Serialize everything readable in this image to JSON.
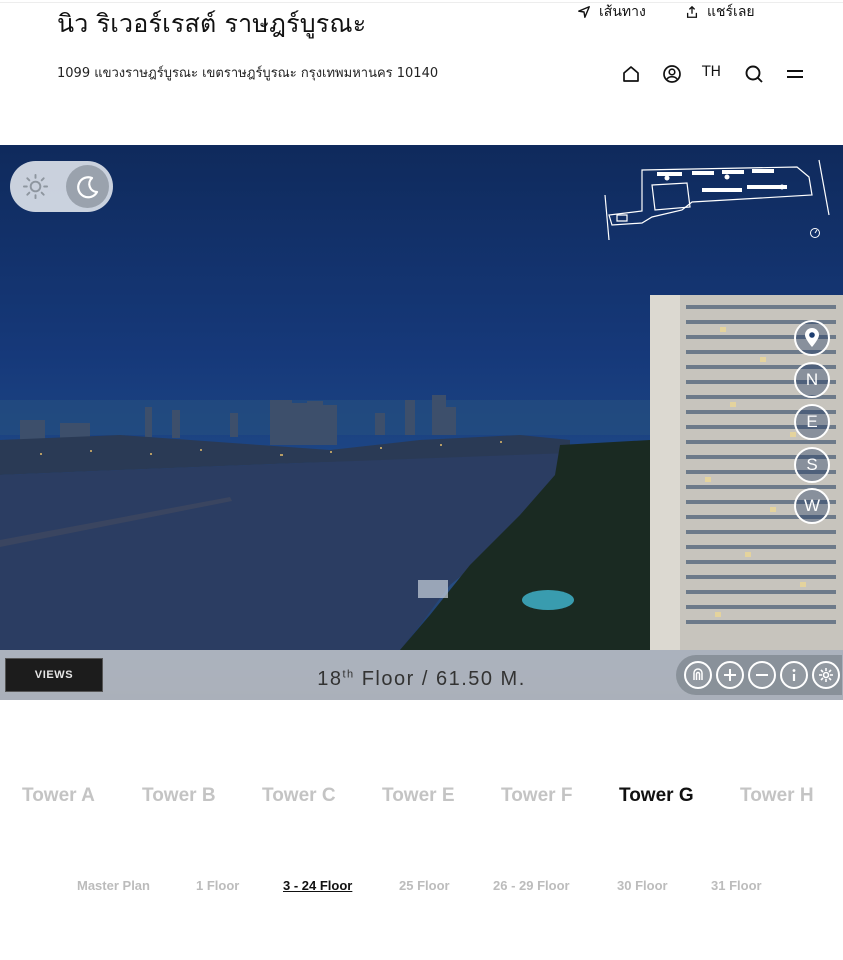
{
  "header": {
    "title": "นิว ริเวอร์เรสต์ ราษฎร์บูรณะ",
    "address": "1099 แขวงราษฎร์บูรณะ เขตราษฎร์บูรณะ กรุงเทพมหานคร 10140",
    "route_label": "เส้นทาง",
    "share_label": "แชร์เลย",
    "lang": "TH",
    "icons": [
      "home-icon",
      "user-icon",
      "search-icon",
      "menu-icon"
    ]
  },
  "viewer": {
    "mode_options": [
      "day",
      "night"
    ],
    "active_mode": "night",
    "compass": [
      "N",
      "E",
      "S",
      "W"
    ],
    "views_label": "VIEWS",
    "floor_ordinal": "18",
    "floor_suffix": "th",
    "floor_text": "Floor / 61.50 M.",
    "tools": [
      "gyro-icon",
      "zoom-in-icon",
      "zoom-out-icon",
      "info-icon",
      "settings-icon"
    ]
  },
  "tower_tabs": [
    {
      "label": "Tower A",
      "active": false
    },
    {
      "label": "Tower B",
      "active": false
    },
    {
      "label": "Tower C",
      "active": false
    },
    {
      "label": "Tower E",
      "active": false
    },
    {
      "label": "Tower F",
      "active": false
    },
    {
      "label": "Tower G",
      "active": true
    },
    {
      "label": "Tower H",
      "active": false
    }
  ],
  "floor_tabs": [
    {
      "label": "Master Plan",
      "active": false
    },
    {
      "label": "1 Floor",
      "active": false
    },
    {
      "label": "3 - 24 Floor",
      "active": true
    },
    {
      "label": "25 Floor",
      "active": false
    },
    {
      "label": "26 - 29 Floor",
      "active": false
    },
    {
      "label": "30 Floor",
      "active": false
    },
    {
      "label": "31 Floor",
      "active": false
    }
  ],
  "colors": {
    "active_tab": "#111111",
    "inactive_tab": "#c4c4c4",
    "sky_top": "#0f2a5c"
  }
}
